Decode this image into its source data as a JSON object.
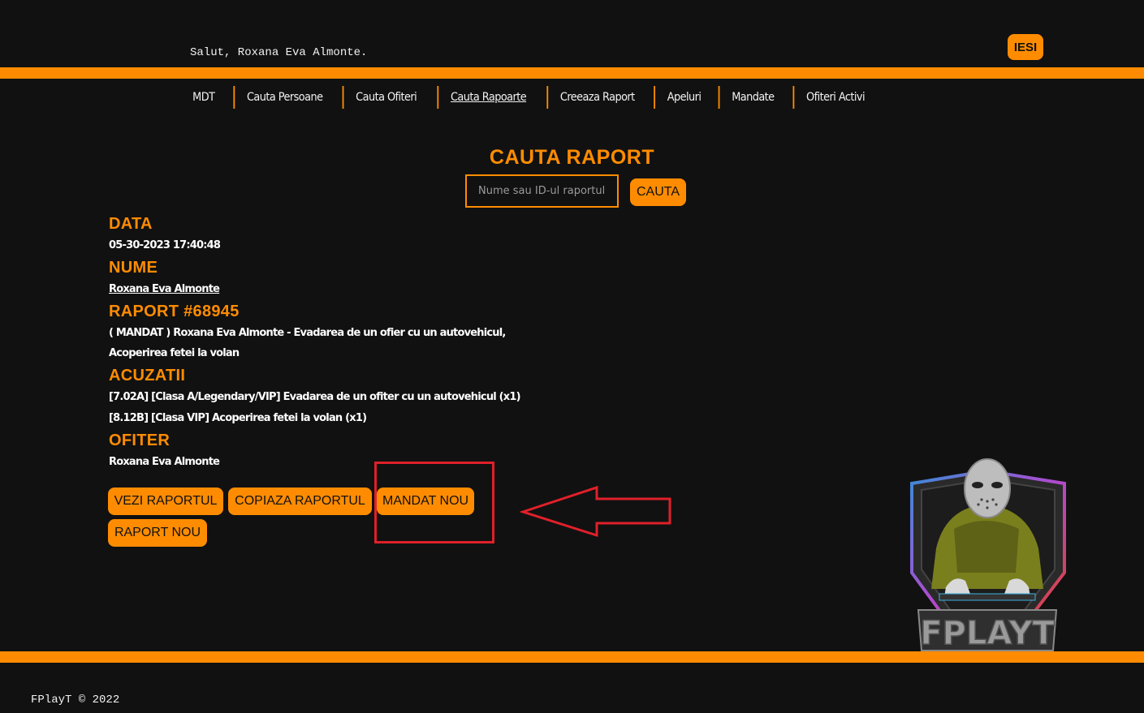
{
  "header": {
    "greeting": "Salut, Roxana Eva Almonte.",
    "exit_label": "IESI"
  },
  "nav": {
    "items": [
      {
        "label": "MDT"
      },
      {
        "label": "Cauta Persoane"
      },
      {
        "label": "Cauta Ofiteri"
      },
      {
        "label": "Cauta Rapoarte",
        "active": true
      },
      {
        "label": "Creeaza Raport"
      },
      {
        "label": "Apeluri"
      },
      {
        "label": "Mandate"
      },
      {
        "label": "Ofiteri Activi"
      }
    ]
  },
  "search": {
    "title": "CAUTA RAPORT",
    "placeholder": "Nume sau ID-ul raportului",
    "button_label": "CAUTA"
  },
  "report": {
    "date_label": "DATA",
    "date_value": "05-30-2023 17:40:48",
    "name_label": "NUME",
    "name_value": "Roxana Eva Almonte",
    "report_label": "RAPORT #68945",
    "report_text": "( MANDAT ) Roxana Eva Almonte - Evadarea de un ofier cu un autovehicul, Acoperirea fetei la volan",
    "charges_label": "ACUZATII",
    "charges": [
      "[7.02A] [Clasa A/Legendary/VIP] Evadarea de un ofiter cu un autovehicul (x1)",
      "[8.12B] [Clasa VIP] Acoperirea fetei la volan (x1)"
    ],
    "officer_label": "OFITER",
    "officer_value": "Roxana Eva Almonte"
  },
  "actions": {
    "view_report": "VEZI RAPORTUL",
    "copy_report": "COPIAZA RAPORTUL",
    "new_warrant": "MANDAT NOU",
    "new_report": "RAPORT NOU"
  },
  "logo": {
    "icon": "hockey-mask-hoodie-gamer-logo",
    "text": "FPLAYT"
  },
  "footer": {
    "text": "FPlayT © 2022"
  },
  "colors": {
    "accent": "#ff8c00",
    "background": "#111111",
    "annotation": "#e0202a"
  }
}
